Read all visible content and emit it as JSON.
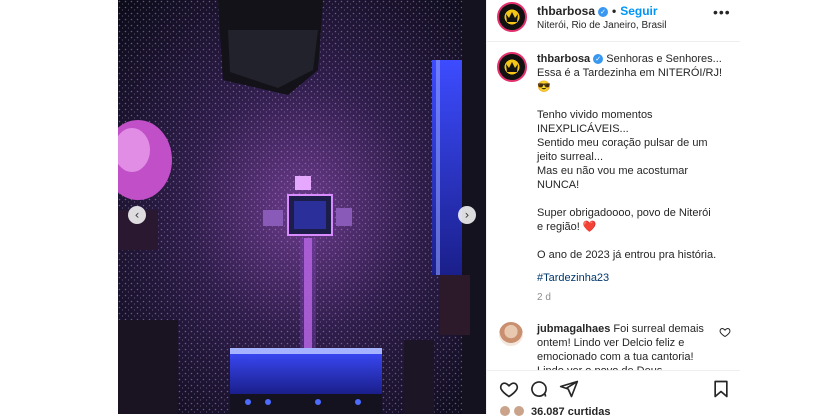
{
  "post": {
    "username": "thbarbosa",
    "follow_label": "Seguir",
    "location": "Niterói, Rio de Janeiro, Brasil",
    "more_label": "•••",
    "verified_glyph": "✓"
  },
  "caption": {
    "username": "thbarbosa",
    "text": " Senhoras e Senhores...\nEssa é a Tardezinha em NITERÓI/RJ!\n😎\n\nTenho vivido momentos\nINEXPLICÁVEIS...\nSentido meu coração pulsar de um\njeito surreal...\nMas eu não vou me acostumar\nNUNCA!\n\nSuper obrigadoooo, povo de Niterói\ne região! ❤️\n\nO ano de 2023 já entrou pra história.",
    "hashtag": "#Tardezinha23",
    "time": "2 d"
  },
  "comment": {
    "username": "jubmagalhaes",
    "text": " Foi surreal demais ontem! Lindo ver Delcio feliz e emocionado com a tua cantoria! Lindo ver o povo de Deus..."
  },
  "likes": {
    "count_label": "36.087 curtidas"
  },
  "carousel": {
    "prev_glyph": "‹",
    "next_glyph": "›"
  },
  "colors": {
    "accent": "#0095f6",
    "verified": "#3897f0",
    "hashtag": "#00376b",
    "muted": "#8e8e8e"
  },
  "icons": [
    "crown-logo-icon",
    "verified-icon",
    "more-icon",
    "heart-icon",
    "comment-icon",
    "share-icon",
    "bookmark-icon",
    "chevron-left-icon",
    "chevron-right-icon"
  ]
}
